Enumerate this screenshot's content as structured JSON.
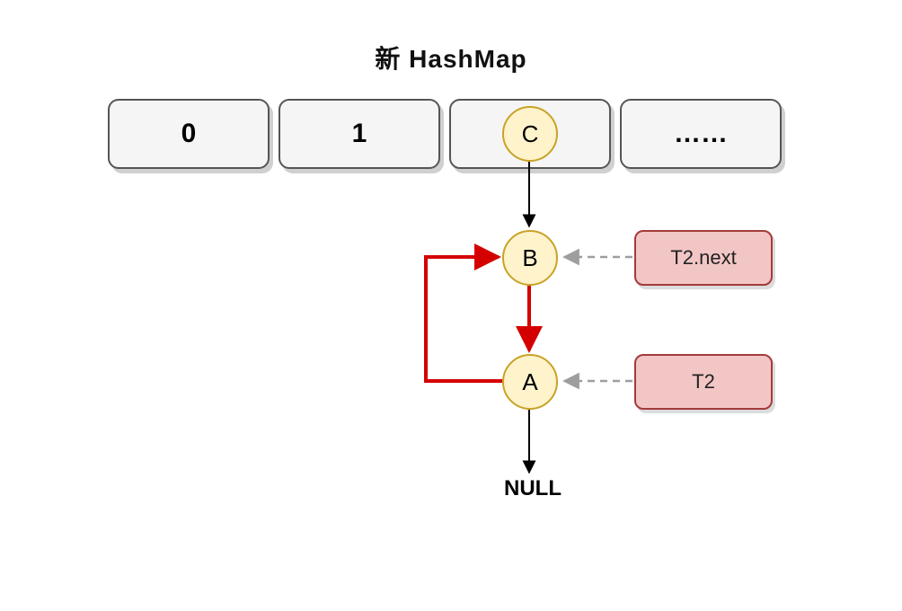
{
  "title": "新 HashMap",
  "buckets": {
    "b0": "0",
    "b1": "1",
    "b3": "……"
  },
  "nodes": {
    "c": "C",
    "b": "B",
    "a": "A"
  },
  "pointers": {
    "t2next": "T2.next",
    "t2": "T2"
  },
  "labels": {
    "null": "NULL"
  },
  "colors": {
    "bucketBorder": "#555555",
    "bucketFill": "#f5f5f5",
    "nodeBorder": "#c9a227",
    "nodeFill": "#fff3cc",
    "pointerBorder": "#a33b3b",
    "pointerFill": "#f3c6c6",
    "arrowBlack": "#000000",
    "arrowRed": "#d40000",
    "arrowGray": "#9e9e9e"
  }
}
